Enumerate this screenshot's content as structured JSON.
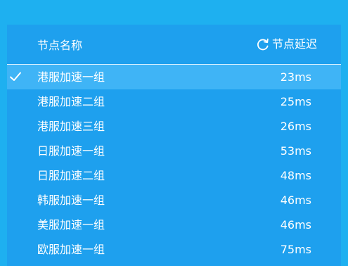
{
  "header": {
    "name_label": "节点名称",
    "latency_label": "节点延迟",
    "refresh_icon": "refresh-icon"
  },
  "colors": {
    "background": "#1eb0f0",
    "panel": "#1ea0ee",
    "selected_row": "#3fb4f6",
    "text": "#ffffff"
  },
  "nodes": [
    {
      "name": "港服加速一组",
      "latency": "23ms",
      "selected": true
    },
    {
      "name": "港服加速二组",
      "latency": "25ms",
      "selected": false
    },
    {
      "name": "港服加速三组",
      "latency": "26ms",
      "selected": false
    },
    {
      "name": "日服加速一组",
      "latency": "53ms",
      "selected": false
    },
    {
      "name": "日服加速二组",
      "latency": "48ms",
      "selected": false
    },
    {
      "name": "韩服加速一组",
      "latency": "46ms",
      "selected": false
    },
    {
      "name": "美服加速一组",
      "latency": "46ms",
      "selected": false
    },
    {
      "name": "欧服加速一组",
      "latency": "75ms",
      "selected": false
    }
  ]
}
